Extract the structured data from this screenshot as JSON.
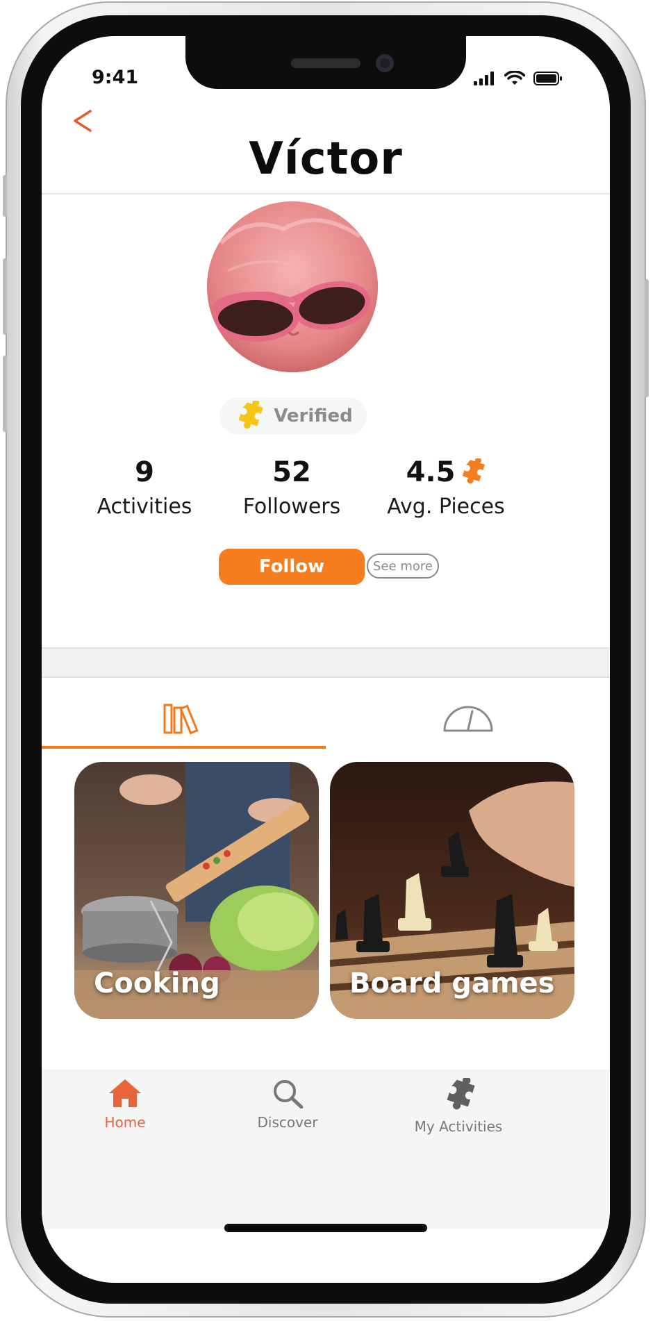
{
  "status_bar": {
    "time": "9:41"
  },
  "header": {
    "title": "Víctor",
    "back_icon": "chevron-left-icon"
  },
  "profile": {
    "verified_label": "Verified",
    "stats": [
      {
        "value": "9",
        "label": "Activities"
      },
      {
        "value": "52",
        "label": "Followers"
      },
      {
        "value": "4.5",
        "label": "Avg. Pieces"
      }
    ],
    "follow_label": "Follow",
    "see_more_label": "See more"
  },
  "tabs": [
    {
      "icon": "library-icon",
      "active": true
    },
    {
      "icon": "gauge-icon",
      "active": false
    }
  ],
  "cards": [
    {
      "label": "Cooking"
    },
    {
      "label": "Board games"
    }
  ],
  "bottom_nav": [
    {
      "label": "Home",
      "icon": "home-icon",
      "active": true
    },
    {
      "label": "Discover",
      "icon": "search-icon",
      "active": false
    },
    {
      "label": "My Activities",
      "icon": "puzzle-icon",
      "active": false
    }
  ],
  "colors": {
    "accent": "#F47D20",
    "title_text": "#0C0C0C",
    "inactive_nav": "#777777",
    "verified_puzzle": "#F5C518"
  }
}
